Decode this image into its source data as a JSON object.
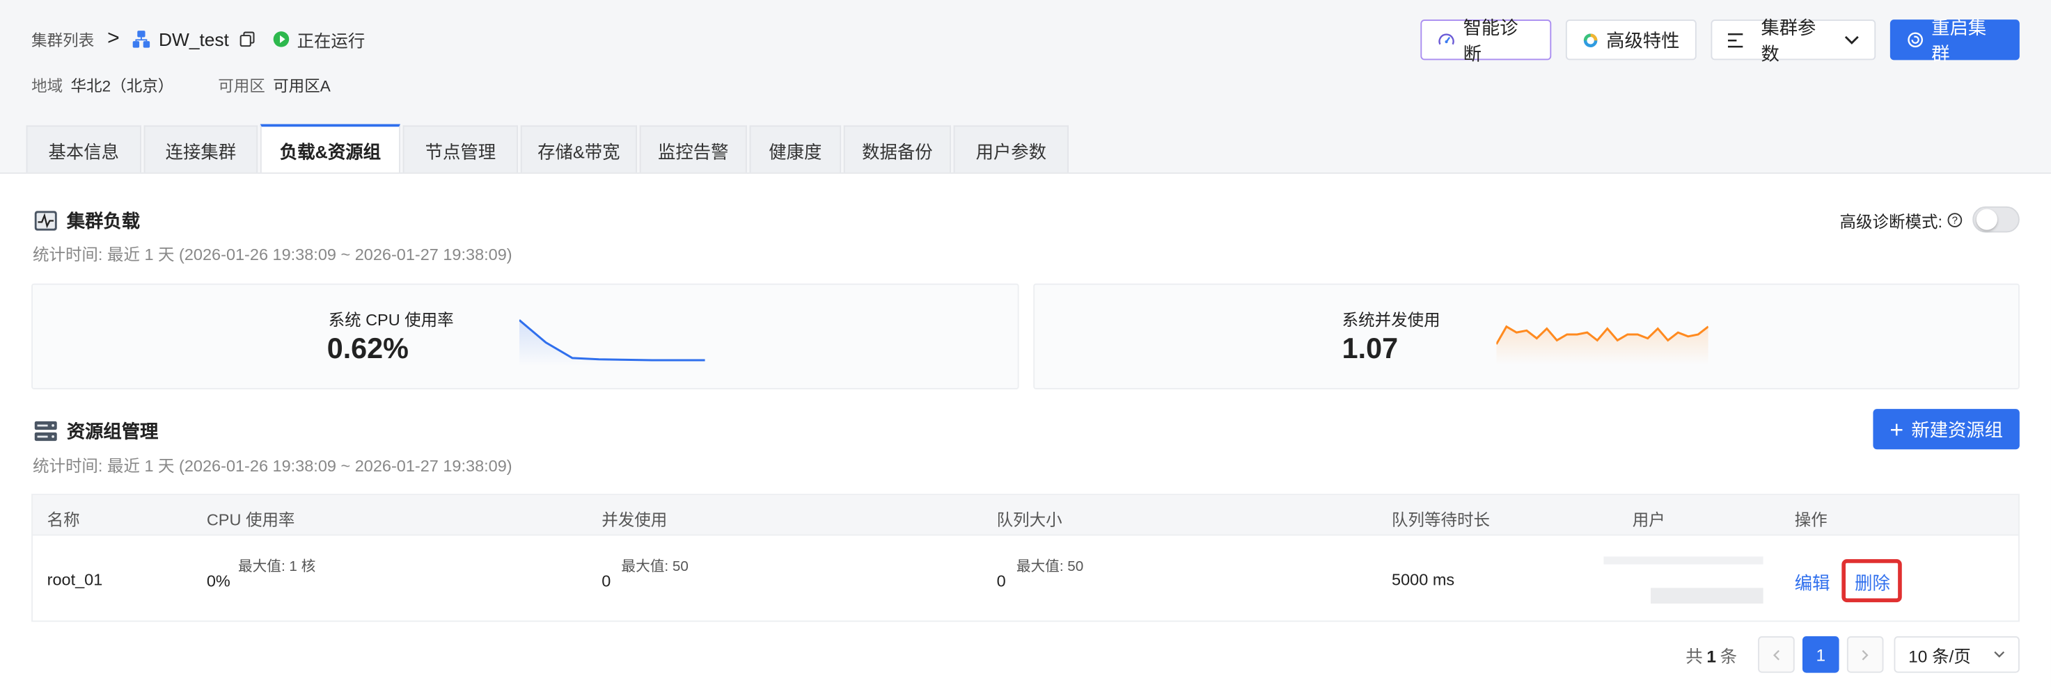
{
  "breadcrumb": {
    "root": "集群列表",
    "separator": ">",
    "cluster_name": "DW_test",
    "status": "正在运行"
  },
  "meta": {
    "region_label": "地域",
    "region_value": "华北2（北京）",
    "zone_label": "可用区",
    "zone_value": "可用区A"
  },
  "actions": {
    "diagnose": "智能诊断",
    "advanced": "高级特性",
    "params": "集群参数",
    "restart": "重启集群"
  },
  "tabs": [
    {
      "label": "基本信息",
      "active": false
    },
    {
      "label": "连接集群",
      "active": false
    },
    {
      "label": "负载&资源组",
      "active": true
    },
    {
      "label": "节点管理",
      "active": false
    },
    {
      "label": "存储&带宽",
      "active": false
    },
    {
      "label": "监控告警",
      "active": false
    },
    {
      "label": "健康度",
      "active": false
    },
    {
      "label": "数据备份",
      "active": false
    },
    {
      "label": "用户参数",
      "active": false
    }
  ],
  "load": {
    "title": "集群负载",
    "stat_time": "统计时间: 最近 1 天 (2026-01-26 19:38:09 ~ 2026-01-27 19:38:09)",
    "advanced_mode_label": "高级诊断模式:",
    "advanced_mode_on": false,
    "cards": [
      {
        "label": "系统 CPU 使用率",
        "value": "0.62%",
        "color": "#2f6fed",
        "trend": [
          1.0,
          0.48,
          0.12,
          0.09,
          0.08,
          0.07,
          0.07,
          0.07
        ]
      },
      {
        "label": "系统并发使用",
        "value": "1.07",
        "color": "#ff8a1f",
        "trend": [
          0.45,
          0.9,
          0.75,
          0.8,
          0.6,
          0.85,
          0.55,
          0.7,
          0.7,
          0.75,
          0.55,
          0.85,
          0.55,
          0.7,
          0.7,
          0.6,
          0.85,
          0.55,
          0.75,
          0.65,
          0.7,
          0.9
        ]
      }
    ]
  },
  "resource_groups": {
    "title": "资源组管理",
    "stat_time": "统计时间: 最近 1 天 (2026-01-26 19:38:09 ~ 2026-01-27 19:38:09)",
    "new_button": "新建资源组",
    "columns": [
      "名称",
      "CPU 使用率",
      "并发使用",
      "队列大小",
      "队列等待时长",
      "用户",
      "操作"
    ],
    "rows": [
      {
        "name": "root_01",
        "cpu": "0%",
        "cpu_max": "最大值: 1 核",
        "concurrency": "0",
        "concurrency_max": "最大值: 50",
        "queue": "0",
        "queue_max": "最大值: 50",
        "wait": "5000 ms",
        "edit": "编辑",
        "delete": "删除"
      }
    ]
  },
  "pagination": {
    "total_prefix": "共",
    "total": "1",
    "total_suffix": "条",
    "current_page": "1",
    "page_size": "10 条/页"
  }
}
